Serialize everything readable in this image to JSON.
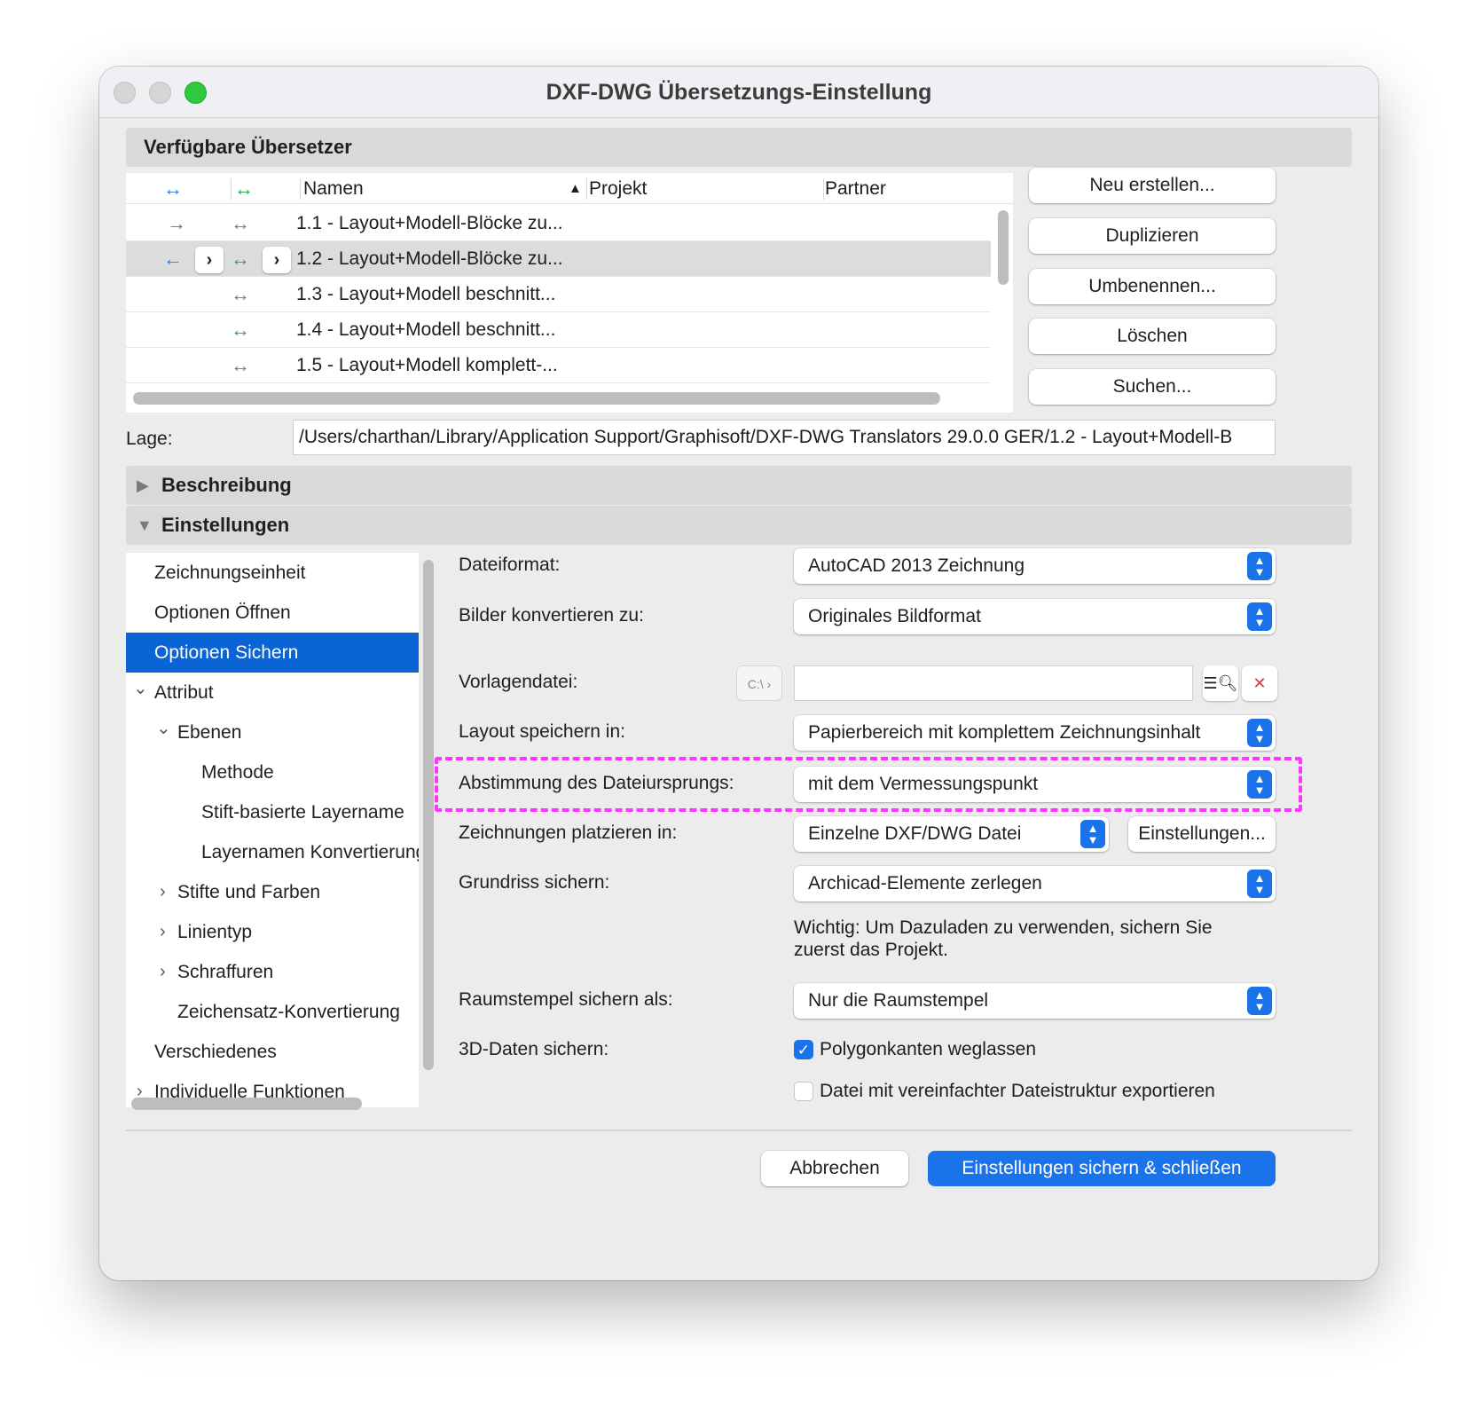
{
  "window": {
    "title": "DXF-DWG Übersetzungs-Einstellung"
  },
  "translators": {
    "section_label": "Verfügbare Übersetzer",
    "columns": {
      "names": "Namen",
      "project": "Projekt",
      "partner": "Partner",
      "sort_indicator": "▲"
    },
    "rows": [
      {
        "name": "1.1 - Layout+Modell-Blöcke zu...",
        "dir": "→"
      },
      {
        "name": "1.2 - Layout+Modell-Blöcke zu...",
        "dir": "←"
      },
      {
        "name": "1.3 - Layout+Modell beschnitt..."
      },
      {
        "name": "1.4 - Layout+Modell beschnitt..."
      },
      {
        "name": "1.5 - Layout+Modell komplett-..."
      }
    ],
    "arrow_both": "↔",
    "chevron": "›"
  },
  "actions": {
    "new": "Neu erstellen...",
    "duplicate": "Duplizieren",
    "rename": "Umbenennen...",
    "delete": "Löschen",
    "search": "Suchen..."
  },
  "location": {
    "label": "Lage:",
    "value": "/Users/charthan/Library/Application Support/Graphisoft/DXF-DWG Translators 29.0.0 GER/1.2 - Layout+Modell-B"
  },
  "description": {
    "label": "Beschreibung",
    "disclosure": "▶"
  },
  "settings": {
    "label": "Einstellungen",
    "disclosure": "▼"
  },
  "nav": {
    "items": [
      {
        "label": "Zeichnungseinheit"
      },
      {
        "label": "Optionen Öffnen"
      },
      {
        "label": "Optionen Sichern"
      },
      {
        "label": "Attribut",
        "chevron": "⌄"
      },
      {
        "label": "Ebenen",
        "chevron": "⌄"
      },
      {
        "label": "Methode"
      },
      {
        "label": "Stift-basierte Layername"
      },
      {
        "label": "Layernamen Konvertierung"
      },
      {
        "label": "Stifte und Farben",
        "chevron": "›"
      },
      {
        "label": "Linientyp",
        "chevron": "›"
      },
      {
        "label": "Schraffuren",
        "chevron": "›"
      },
      {
        "label": "Zeichensatz-Konvertierung"
      },
      {
        "label": "Verschiedenes"
      },
      {
        "label": "Individuelle Funktionen",
        "chevron": "›"
      }
    ]
  },
  "form": {
    "file_format": {
      "label": "Dateiformat:",
      "value": "AutoCAD 2013 Zeichnung"
    },
    "convert_images": {
      "label": "Bilder konvertieren zu:",
      "value": "Originales Bildformat"
    },
    "template_file": {
      "label": "Vorlagendatei:",
      "value": "",
      "path_icon": "C:\\"
    },
    "save_layout": {
      "label": "Layout speichern in:",
      "value": "Papierbereich mit komplettem Zeichnungsinhalt"
    },
    "file_origin": {
      "label": "Abstimmung des Dateiursprungs:",
      "value": "mit dem Vermessungspunkt"
    },
    "place_drawings": {
      "label": "Zeichnungen platzieren in:",
      "value": "Einzelne DXF/DWG Datei",
      "settings_button": "Einstellungen..."
    },
    "save_plan": {
      "label": "Grundriss sichern:",
      "value": "Archicad-Elemente zerlegen"
    },
    "note": "Wichtig: Um Dazuladen zu verwenden, sichern Sie zuerst das Projekt.",
    "zone_stamp": {
      "label": "Raumstempel sichern als:",
      "value": "Nur die Raumstempel"
    },
    "save_3d": {
      "label": "3D-Daten sichern:",
      "omit_edges": {
        "label": "Polygonkanten weglassen",
        "checked": true
      },
      "simple_structure": {
        "label": "Datei mit vereinfachter Dateistruktur exportieren",
        "checked": false
      }
    }
  },
  "footer": {
    "cancel": "Abbrechen",
    "save_close": "Einstellungen sichern & schließen"
  },
  "colors": {
    "accent": "#1a73e8",
    "selection": "#0a64d6",
    "highlight": "#ff35ff",
    "arrow_green": "#27a84a",
    "arrow_blue": "#2f7be0"
  }
}
